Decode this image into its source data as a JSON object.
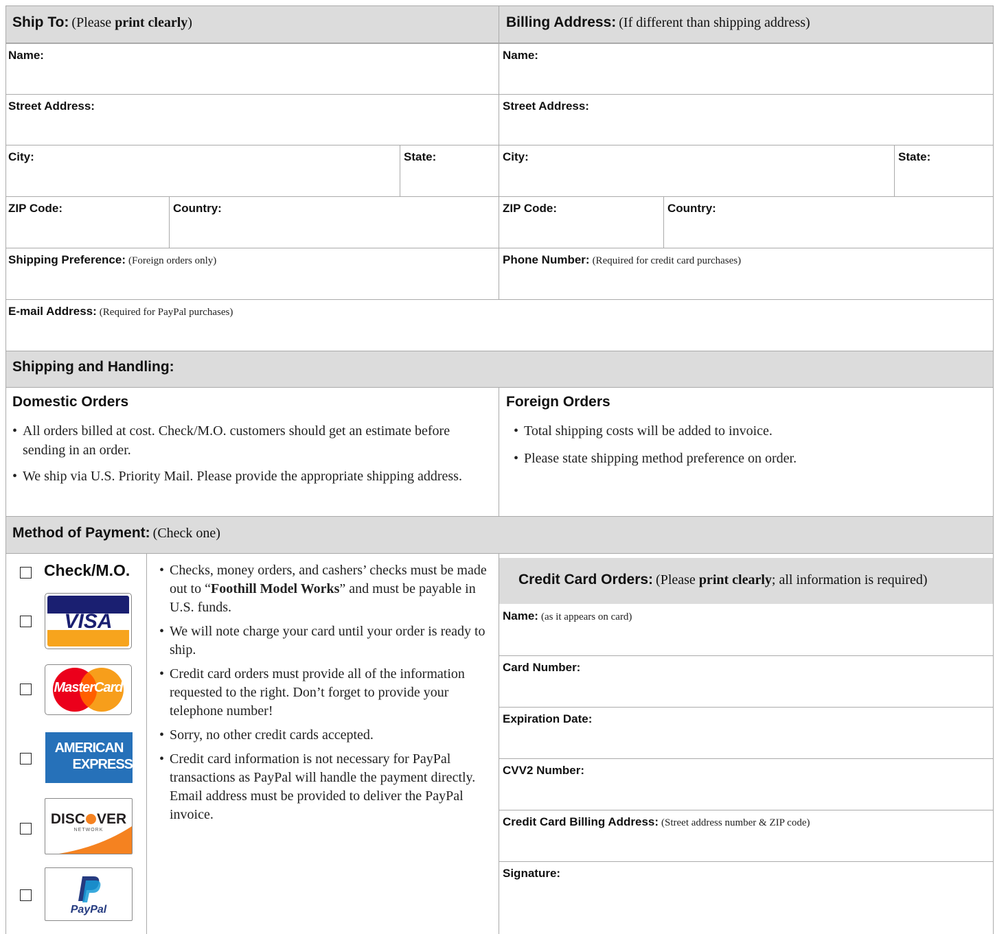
{
  "ship_to": {
    "title": "Ship To:",
    "note_prefix": "(Please ",
    "note_bold": "print clearly",
    "note_suffix": ")",
    "fields": {
      "name": "Name:",
      "street": "Street Address:",
      "city": "City:",
      "state": "State:",
      "zip": "ZIP Code:",
      "country": "Country:",
      "shipping_pref": "Shipping Preference:",
      "shipping_pref_note": "(Foreign orders only)",
      "email": "E-mail Address:",
      "email_note": "(Required for PayPal purchases)"
    }
  },
  "billing": {
    "title": "Billing Address:",
    "note": "(If different than shipping address)",
    "fields": {
      "name": "Name:",
      "street": "Street Address:",
      "city": "City:",
      "state": "State:",
      "zip": "ZIP Code:",
      "country": "Country:",
      "phone": "Phone Number:",
      "phone_note": "(Required for credit card purchases)"
    }
  },
  "shipping_handling": {
    "title": "Shipping and Handling:",
    "domestic": {
      "title": "Domestic Orders",
      "items": [
        "All orders billed at cost. Check/M.O. customers should get an estimate before sending in an order.",
        "We ship via U.S. Priority Mail. Please provide the appropriate shipping address."
      ]
    },
    "foreign": {
      "title": "Foreign Orders",
      "items": [
        "Total shipping costs will be added to invoice.",
        "Please state shipping method preference on order."
      ]
    }
  },
  "payment": {
    "title": "Method of Payment:",
    "note": "(Check one)",
    "options": {
      "check": "Check/M.O.",
      "visa": "VISA",
      "mastercard": "MasterCard",
      "amex_line1": "AMERICAN",
      "amex_line2": "EXPRESS",
      "discover": "DISC",
      "discover_end": "VER",
      "discover_sub": "NETWORK",
      "paypal": "PayPal"
    },
    "info_pre": "Checks, money orders, and cashers’ checks must be made out to “",
    "info_bold": "Foothill Model Works",
    "info_post": "” and must be payable in U.S. funds.",
    "info_items": [
      "We will note charge your card until your order is ready to ship.",
      "Credit card orders must provide all of the information requested to the right. Don’t forget to provide your telephone number!",
      "Sorry, no other credit cards accepted.",
      "Credit card information is not necessary for PayPal transactions as PayPal will handle the payment directly. Email address must be provided to deliver the PayPal invoice."
    ]
  },
  "credit_card": {
    "title": "Credit Card Orders:",
    "note_prefix": "(Please ",
    "note_bold": "print clearly",
    "note_suffix": "; all information is required)",
    "fields": {
      "name": "Name:",
      "name_note": "(as it appears on card)",
      "card_number": "Card Number:",
      "expiration": "Expiration Date:",
      "cvv2": "CVV2 Number:",
      "billing_address": "Credit Card Billing Address:",
      "billing_address_note": "(Street address number & ZIP code)",
      "signature": "Signature:"
    }
  },
  "colors": {
    "header_bg": "#dcdcdc",
    "visa_blue": "#1a1f71",
    "visa_gold": "#f7a41d",
    "mc_red": "#eb001b",
    "mc_orange": "#f79e1b",
    "amex_blue": "#2671b9",
    "discover_orange": "#f58220",
    "paypal_dark": "#253b80",
    "paypal_light": "#179bd7"
  }
}
